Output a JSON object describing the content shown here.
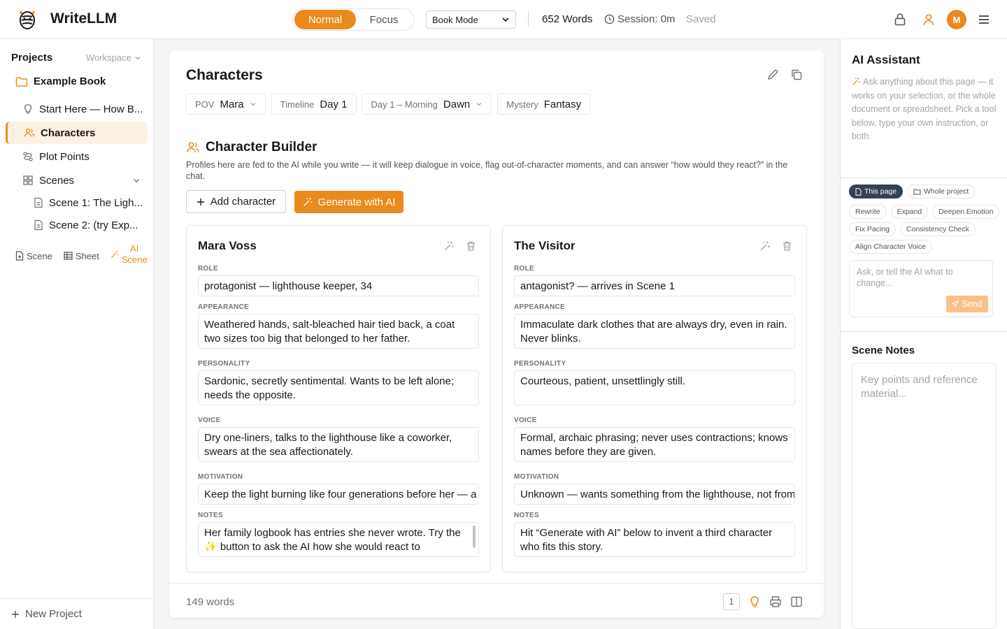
{
  "header": {
    "app_title": "WriteLLM",
    "mode_normal": "Normal",
    "mode_focus": "Focus",
    "book_mode": "Book Mode",
    "word_count": "652 Words",
    "session": "Session: 0m",
    "saved": "Saved",
    "avatar_initial": "M",
    "accent_color": "#ea8a1e"
  },
  "sidebar": {
    "title": "Projects",
    "workspace": "Workspace",
    "book": "Example Book",
    "items": [
      {
        "label": "Start Here — How B...",
        "icon": "lightbulb-icon"
      },
      {
        "label": "Characters",
        "icon": "users-icon"
      },
      {
        "label": "Plot Points",
        "icon": "route-icon"
      },
      {
        "label": "Scenes",
        "icon": "grid-icon"
      },
      {
        "label": "Scene 1: The Ligh...",
        "icon": "file-icon"
      },
      {
        "label": "Scene 2: (try Exp...",
        "icon": "file-icon"
      }
    ],
    "tools": {
      "scene": "Scene",
      "sheet": "Sheet",
      "ai_line1": "AI",
      "ai_line2": "Scene"
    },
    "new_project": "New Project"
  },
  "main": {
    "title": "Characters",
    "chips": [
      {
        "label": "POV",
        "value": "Mara"
      },
      {
        "label": "Timeline",
        "value": "Day 1"
      },
      {
        "label": "Day 1 – Morning",
        "value": "Dawn"
      },
      {
        "label": "Mystery",
        "value": "Fantasy"
      }
    ],
    "builder_title": "Character Builder",
    "builder_desc": "Profiles here are fed to the AI while you write — it will keep dialogue in voice, flag out-of-character moments, and can answer “how would they react?” in the chat.",
    "add_character": "Add character",
    "generate_ai": "Generate with AI",
    "field_labels": {
      "role": "ROLE",
      "appearance": "APPEARANCE",
      "personality": "PERSONALITY",
      "voice": "VOICE",
      "motivation": "MOTIVATION",
      "notes": "NOTES"
    },
    "characters": [
      {
        "name": "Mara Voss",
        "role": "protagonist — lighthouse keeper, 34",
        "appearance": "Weathered hands, salt-bleached hair tied back, a coat two sizes too big that belonged to her father.",
        "personality": "Sardonic, secretly sentimental. Wants to be left alone; needs the opposite.",
        "voice": "Dry one-liners, talks to the lighthouse like a coworker, swears at the sea affectionately.",
        "motivation": "Keep the light burning like four generations before her — a",
        "notes": "Her family logbook has entries she never wrote. Try the ✨ button to ask the AI how she would react to"
      },
      {
        "name": "The Visitor",
        "role": "antagonist? — arrives in Scene 1",
        "appearance": "Immaculate dark clothes that are always dry, even in rain. Never blinks.",
        "personality": "Courteous, patient, unsettlingly still.",
        "voice": "Formal, archaic phrasing; never uses contractions; knows names before they are given.",
        "motivation": "Unknown — wants something from the lighthouse, not from",
        "notes": "Hit “Generate with AI” below to invent a third character who fits this story."
      }
    ],
    "footer_words": "149 words",
    "page_number": "1"
  },
  "assistant": {
    "title": "AI Assistant",
    "desc": "Ask anything about this page — it works on your selection, or the whole document or spreadsheet. Pick a tool below, type your own instruction, or both.",
    "scope_page": "This page",
    "scope_project": "Whole project",
    "tools": [
      "Rewrite",
      "Expand",
      "Deepen Emotion",
      "Fix Pacing",
      "Consistency Check",
      "Align Character Voice"
    ],
    "ask_placeholder": "Ask, or tell the AI what to change...",
    "send": "Send",
    "notes_title": "Scene Notes",
    "notes_placeholder": "Key points and reference material..."
  }
}
